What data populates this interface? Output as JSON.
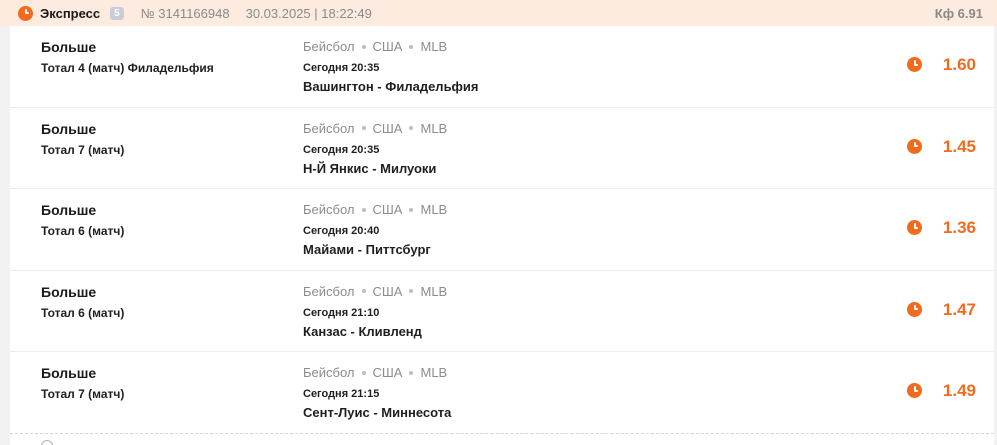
{
  "header": {
    "title": "Экспресс",
    "count": "5",
    "ticket_number": "№ 3141166948",
    "datetime": "30.03.2025 | 18:22:49",
    "coefficient": "Кф 6.91"
  },
  "colors": {
    "accent": "#f26b1d",
    "header_bg": "#fdebe0"
  },
  "icons": {
    "status": "clock-icon",
    "footer": "info-icon"
  },
  "bets": [
    {
      "market": "Больше",
      "selection": "Тотал 4 (матч) Филадельфия",
      "sport": "Бейсбол",
      "country": "США",
      "league": "MLB",
      "time": "Сегодня 20:35",
      "teams": "Вашингтон - Филадельфия",
      "odd": "1.60"
    },
    {
      "market": "Больше",
      "selection": "Тотал 7 (матч)",
      "sport": "Бейсбол",
      "country": "США",
      "league": "MLB",
      "time": "Сегодня 20:35",
      "teams": "Н-Й Янкис - Милуоки",
      "odd": "1.45"
    },
    {
      "market": "Больше",
      "selection": "Тотал 6 (матч)",
      "sport": "Бейсбол",
      "country": "США",
      "league": "MLB",
      "time": "Сегодня 20:40",
      "teams": "Майами - Питтсбург",
      "odd": "1.36"
    },
    {
      "market": "Больше",
      "selection": "Тотал 6 (матч)",
      "sport": "Бейсбол",
      "country": "США",
      "league": "MLB",
      "time": "Сегодня 21:10",
      "teams": "Канзас - Кливленд",
      "odd": "1.47"
    },
    {
      "market": "Больше",
      "selection": "Тотал 7 (матч)",
      "sport": "Бейсбол",
      "country": "США",
      "league": "MLB",
      "time": "Сегодня 21:15",
      "teams": "Сент-Луис - Миннесота",
      "odd": "1.49"
    }
  ]
}
